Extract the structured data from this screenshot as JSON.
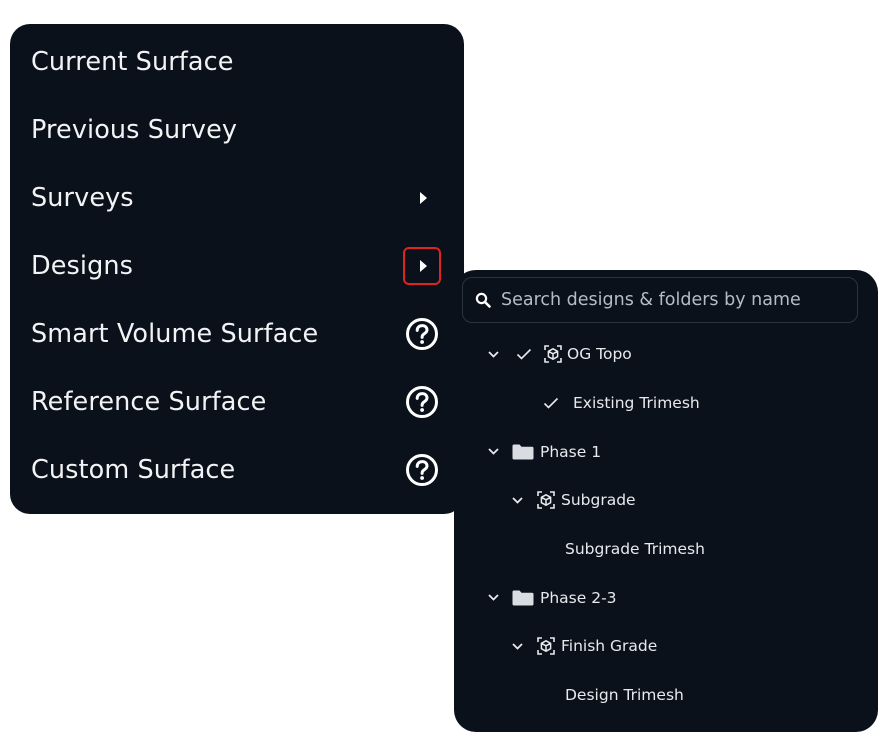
{
  "menu": {
    "items": [
      {
        "label": "Current Surface",
        "trailing": ""
      },
      {
        "label": "Previous Survey",
        "trailing": ""
      },
      {
        "label": "Surveys",
        "trailing": "caret-right-icon"
      },
      {
        "label": "Designs",
        "trailing": "caret-right-icon"
      },
      {
        "label": "Smart Volume Surface",
        "trailing": "help-circle-icon"
      },
      {
        "label": "Reference Surface",
        "trailing": "help-circle-icon"
      },
      {
        "label": "Custom Surface",
        "trailing": "help-circle-icon"
      }
    ],
    "highlight_color": "#e0241d"
  },
  "designs_panel": {
    "search": {
      "placeholder": "Search designs & folders by name",
      "value": ""
    },
    "tree": [
      {
        "label": "OG Topo",
        "type": "design",
        "expanded": true,
        "checked": true
      },
      {
        "label": "Existing Trimesh",
        "type": "surface",
        "checked": true
      },
      {
        "label": "Phase 1",
        "type": "folder",
        "expanded": true
      },
      {
        "label": "Subgrade",
        "type": "design",
        "expanded": true
      },
      {
        "label": "Subgrade Trimesh",
        "type": "surface"
      },
      {
        "label": "Phase 2-3",
        "type": "folder",
        "expanded": true
      },
      {
        "label": "Finish Grade",
        "type": "design",
        "expanded": true
      },
      {
        "label": "Design Trimesh",
        "type": "surface"
      }
    ]
  },
  "colors": {
    "panel_bg": "#0b111b",
    "text": "#f2f3f5",
    "folder": "#d9dce1"
  }
}
